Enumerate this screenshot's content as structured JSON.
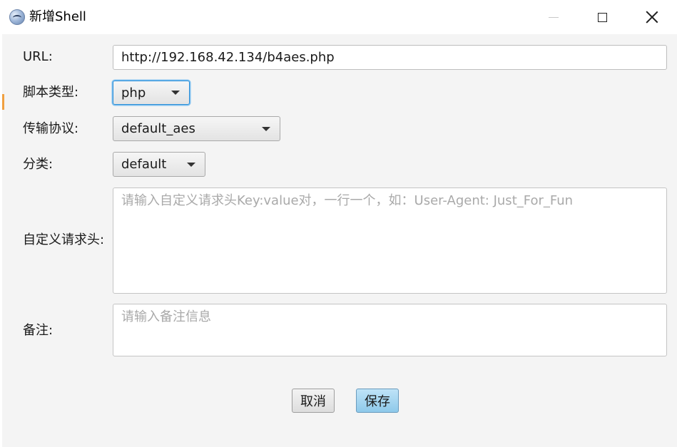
{
  "window": {
    "title": "新增Shell",
    "icon": "shell-manager-icon"
  },
  "form": {
    "url": {
      "label": "URL:",
      "value": "http://192.168.42.134/b4aes.php"
    },
    "script_type": {
      "label": "脚本类型:",
      "value": "php"
    },
    "protocol": {
      "label": "传输协议:",
      "value": "default_aes"
    },
    "category": {
      "label": "分类:",
      "value": "default"
    },
    "headers": {
      "label": "自定义请求头:",
      "placeholder": "请输入自定义请求头Key:value对，一行一个，如：User-Agent: Just_For_Fun",
      "value": ""
    },
    "remark": {
      "label": "备注:",
      "placeholder": "请输入备注信息",
      "value": ""
    }
  },
  "buttons": {
    "cancel": "取消",
    "save": "保存"
  },
  "colors": {
    "focus": "#2b8ed8",
    "primary_button": "#8ec9ea"
  }
}
